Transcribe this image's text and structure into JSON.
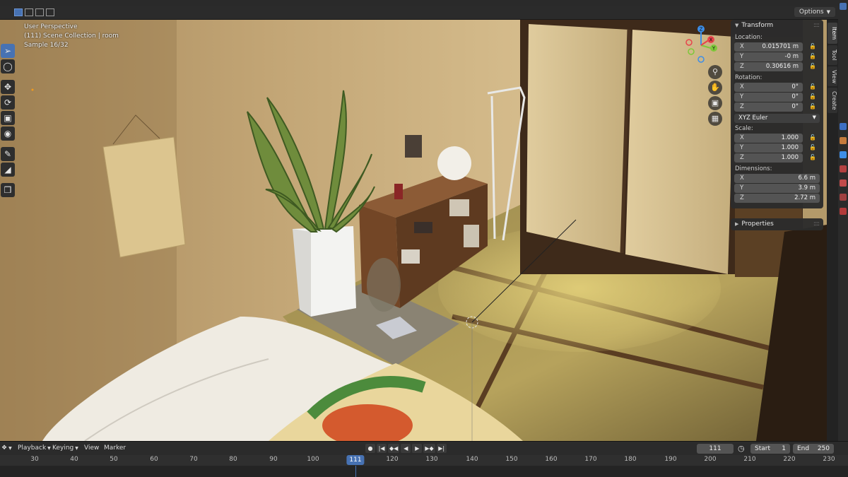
{
  "header": {
    "options_label": "Options"
  },
  "viewport": {
    "overlay_line1": "User Perspective",
    "overlay_line2": "(111) Scene Collection | room",
    "overlay_line3": "Sample 16/32"
  },
  "gizmo": {
    "z_label": "Z",
    "y_label": "Y",
    "x_label": "X"
  },
  "npanel": {
    "transform_title": "Transform",
    "location_label": "Location:",
    "location": [
      {
        "axis": "X",
        "value": "0.015701 m"
      },
      {
        "axis": "Y",
        "value": "-0 m"
      },
      {
        "axis": "Z",
        "value": "0.30616 m"
      }
    ],
    "rotation_label": "Rotation:",
    "rotation": [
      {
        "axis": "X",
        "value": "0°"
      },
      {
        "axis": "Y",
        "value": "0°"
      },
      {
        "axis": "Z",
        "value": "0°"
      }
    ],
    "rotation_mode": "XYZ Euler",
    "scale_label": "Scale:",
    "scale": [
      {
        "axis": "X",
        "value": "1.000"
      },
      {
        "axis": "Y",
        "value": "1.000"
      },
      {
        "axis": "Z",
        "value": "1.000"
      }
    ],
    "dimensions_label": "Dimensions:",
    "dimensions": [
      {
        "axis": "X",
        "value": "6.6 m"
      },
      {
        "axis": "Y",
        "value": "3.9 m"
      },
      {
        "axis": "Z",
        "value": "2.72 m"
      }
    ],
    "properties_title": "Properties",
    "tabs": [
      "Item",
      "Tool",
      "View",
      "Create"
    ]
  },
  "timeline": {
    "menus": [
      "Playback",
      "Keying",
      "View",
      "Marker"
    ],
    "current_frame": "111",
    "start_label": "Start",
    "start_value": "1",
    "end_label": "End",
    "end_value": "250",
    "ruler_ticks": [
      "30",
      "40",
      "50",
      "60",
      "70",
      "80",
      "90",
      "100",
      "120",
      "130",
      "140",
      "150",
      "160",
      "170",
      "180",
      "190",
      "200",
      "210",
      "220",
      "230"
    ]
  },
  "colors": {
    "accent": "#4772b3",
    "panel_bg": "#2c2c2c",
    "field_bg": "#545454",
    "axis_x": "#e8434b",
    "axis_y": "#7ec73a",
    "axis_z": "#3d8ee8"
  }
}
